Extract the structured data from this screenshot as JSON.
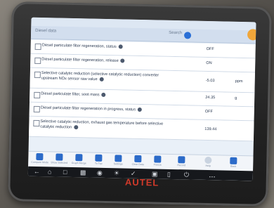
{
  "header": {
    "title": "Diesel data",
    "search_label": "Search",
    "buttons": [
      "",
      ""
    ]
  },
  "rows": [
    {
      "name": "Diesel particulate filter regeneration, status",
      "value": "OFF",
      "unit": ""
    },
    {
      "name": "Diesel particulate filter regeneration, release",
      "value": "ON",
      "unit": ""
    },
    {
      "name": "Selective catalytic reduction (selective catalytic reduction) converter upstream NOx sensor raw value",
      "value": "-5.03",
      "unit": "ppm"
    },
    {
      "name": "Diesel particulate filter, soot mass",
      "value": "24.35",
      "unit": "g"
    },
    {
      "name": "Diesel particulate filter regeneration in progress, status",
      "value": "OFF",
      "unit": ""
    },
    {
      "name": "Selective catalytic reduction, exhaust gas temperature before selective catalytic reduction",
      "value": "139.44",
      "unit": ""
    }
  ],
  "toolbar": [
    {
      "label": "Compare Mode",
      "icon": "compare-icon"
    },
    {
      "label": "Show Selected",
      "icon": "list-icon"
    },
    {
      "label": "Graph Merge",
      "icon": "merge-icon"
    },
    {
      "label": "To Top",
      "icon": "arrow-up-icon"
    },
    {
      "label": "Settings",
      "icon": "gear-icon"
    },
    {
      "label": "Clear Data",
      "icon": "trash-icon"
    },
    {
      "label": "Freeze",
      "icon": "freeze-icon"
    },
    {
      "label": "Record",
      "icon": "camera-icon"
    },
    {
      "label": "Help",
      "icon": "help-icon"
    },
    {
      "label": "Back",
      "icon": "back-icon"
    }
  ],
  "brand": "AUTEL"
}
